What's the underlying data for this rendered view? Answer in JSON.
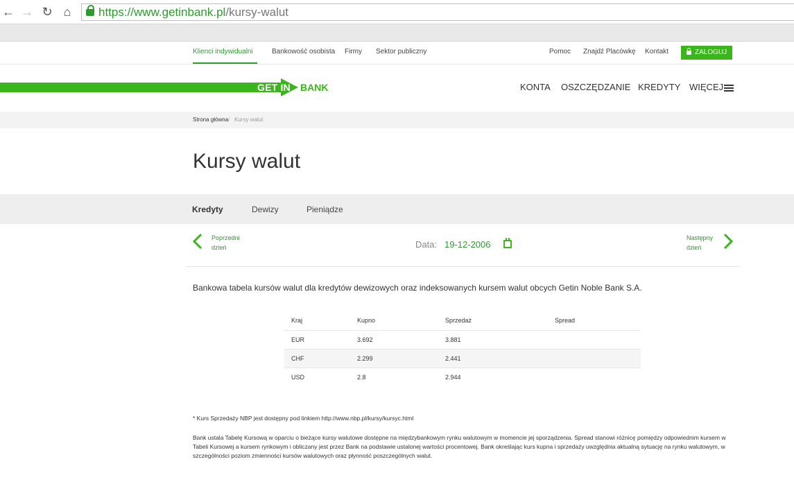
{
  "browser": {
    "url_scheme": "https://",
    "url_host": "www.getinbank.pl",
    "url_path": "/kursy-walut"
  },
  "toplinks": {
    "items": [
      "Klienci indywidualni",
      "Bankowość osobista",
      "Firmy",
      "Sektor publiczny"
    ],
    "right": [
      "Pomoc",
      "Znajdź Placówkę",
      "Kontakt"
    ],
    "login": "ZALOGUJ"
  },
  "logo": {
    "part1": "GET IN",
    "part2": "BANK"
  },
  "mainnav": [
    "KONTA",
    "OSZCZĘDZANIE",
    "KREDYTY",
    "WIĘCEJ"
  ],
  "breadcrumb": {
    "home": "Strona główna",
    "sep": "/",
    "current": "Kursy walut"
  },
  "page_title": "Kursy walut",
  "tabs": [
    "Kredyty",
    "Dewizy",
    "Pieniądze"
  ],
  "datenav": {
    "prev_line1": "Poprzedni",
    "prev_line2": "dzień",
    "next_line1": "Następny",
    "next_line2": "dzień",
    "date_label": "Data:",
    "date_value": "19-12-2006"
  },
  "intro": "Bankowa tabela kursów walut dla kredytów dewizowych oraz indeksowanych kursem walut obcych Getin Noble Bank S.A.",
  "table": {
    "headers": [
      "Kraj",
      "Kupno",
      "Sprzedaż",
      "Spread"
    ],
    "rows": [
      [
        "EUR",
        "3.692",
        "3.881",
        ""
      ],
      [
        "CHF",
        "2.299",
        "2.441",
        ""
      ],
      [
        "USD",
        "2.8",
        "2.944",
        ""
      ]
    ]
  },
  "note": "* Kurs Sprzedaży NBP jest dostępny pod linkiem http://www.nbp.pl/kursy/kursyc.html",
  "disclaimer": "Bank ustala Tabelę Kursową w oparciu o bieżące kursy walutowe dostępne na międzybankowym rynku walutowym w momencie jej sporządzenia. Spread stanowi różnicę pomiędzy odpowiednim kursem w Tabeli Kursowej a kursem rynkowym i obliczany jest przez Bank na podstawie ustalonej wartości procentowej. Bank określając kurs kupna i sprzedaży uwzględnia aktualną sytuację na rynku walutowym, w szczególności poziom zmienności kursów walutowych oraz płynność poszczególnych walut.",
  "colors": {
    "brand_green": "#3bb51c",
    "link_green": "#2e9a2e"
  }
}
